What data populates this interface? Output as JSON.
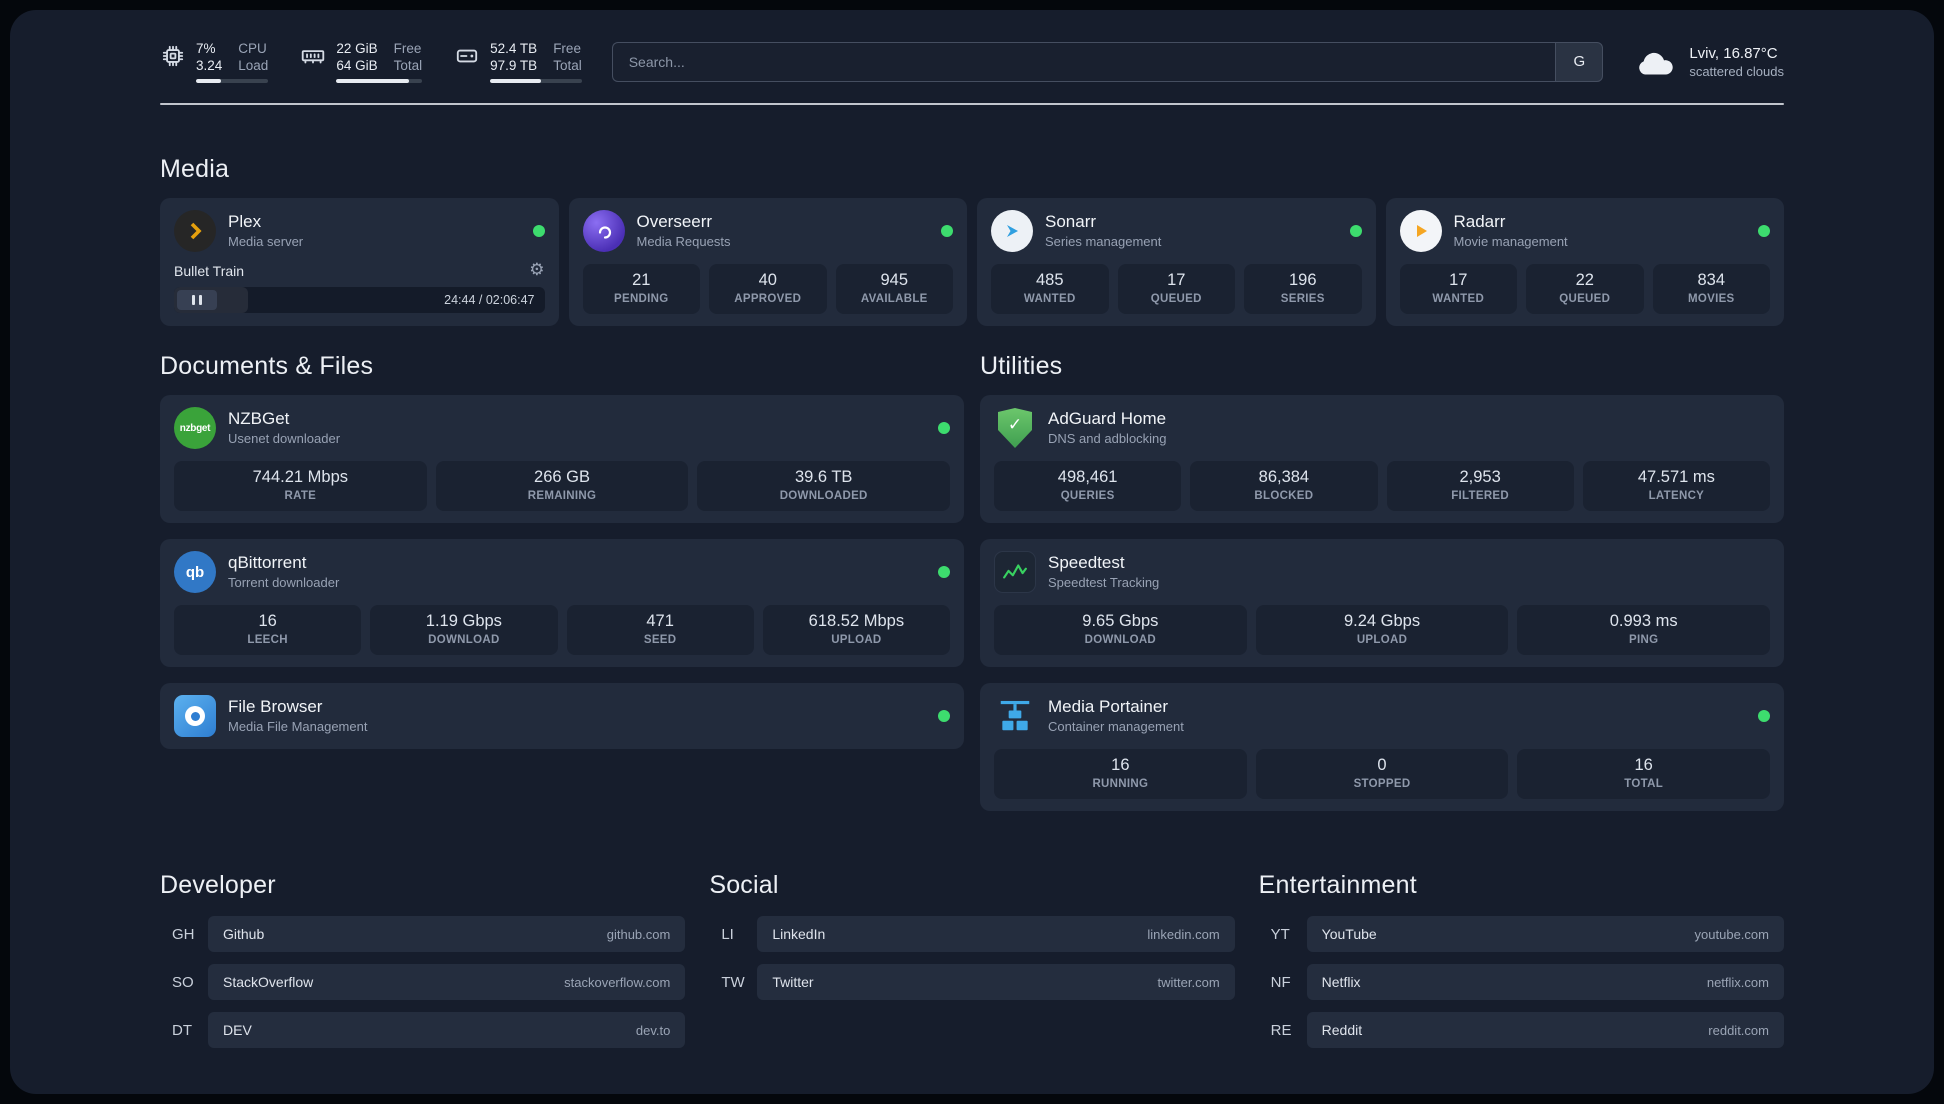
{
  "topbar": {
    "cpu": {
      "value": "7%",
      "sub": "3.24",
      "labels": [
        "CPU",
        "Load"
      ],
      "percent": 35
    },
    "ram": {
      "value": "22 GiB",
      "sub": "64 GiB",
      "labels": [
        "Free",
        "Total"
      ],
      "percent": 85
    },
    "disk": {
      "value": "52.4 TB",
      "sub": "97.9 TB",
      "labels": [
        "Free",
        "Total"
      ],
      "percent": 55
    },
    "search": {
      "placeholder": "Search...",
      "button_label": "G"
    },
    "weather": {
      "location": "Lviv, 16.87°C",
      "condition": "scattered clouds"
    }
  },
  "section_titles": {
    "media": "Media",
    "documents": "Documents & Files",
    "utilities": "Utilities",
    "developer": "Developer",
    "social": "Social",
    "entertainment": "Entertainment"
  },
  "media": [
    {
      "name": "Plex",
      "desc": "Media server",
      "now_playing": {
        "title": "Bullet Train",
        "time": "24:44 / 02:06:47",
        "progress_percent": 20
      }
    },
    {
      "name": "Overseerr",
      "desc": "Media Requests",
      "stats": [
        {
          "value": "21",
          "label": "PENDING"
        },
        {
          "value": "40",
          "label": "APPROVED"
        },
        {
          "value": "945",
          "label": "AVAILABLE"
        }
      ]
    },
    {
      "name": "Sonarr",
      "desc": "Series management",
      "stats": [
        {
          "value": "485",
          "label": "WANTED"
        },
        {
          "value": "17",
          "label": "QUEUED"
        },
        {
          "value": "196",
          "label": "SERIES"
        }
      ]
    },
    {
      "name": "Radarr",
      "desc": "Movie management",
      "stats": [
        {
          "value": "17",
          "label": "WANTED"
        },
        {
          "value": "22",
          "label": "QUEUED"
        },
        {
          "value": "834",
          "label": "MOVIES"
        }
      ]
    }
  ],
  "documents": [
    {
      "name": "NZBGet",
      "desc": "Usenet downloader",
      "stats": [
        {
          "value": "744.21 Mbps",
          "label": "RATE"
        },
        {
          "value": "266 GB",
          "label": "REMAINING"
        },
        {
          "value": "39.6 TB",
          "label": "DOWNLOADED"
        }
      ]
    },
    {
      "name": "qBittorrent",
      "desc": "Torrent downloader",
      "stats": [
        {
          "value": "16",
          "label": "LEECH"
        },
        {
          "value": "1.19 Gbps",
          "label": "DOWNLOAD"
        },
        {
          "value": "471",
          "label": "SEED"
        },
        {
          "value": "618.52 Mbps",
          "label": "UPLOAD"
        }
      ]
    },
    {
      "name": "File Browser",
      "desc": "Media File Management"
    }
  ],
  "utilities": [
    {
      "name": "AdGuard Home",
      "desc": "DNS and adblocking",
      "stats": [
        {
          "value": "498,461",
          "label": "QUERIES"
        },
        {
          "value": "86,384",
          "label": "BLOCKED"
        },
        {
          "value": "2,953",
          "label": "FILTERED"
        },
        {
          "value": "47.571 ms",
          "label": "LATENCY"
        }
      ]
    },
    {
      "name": "Speedtest",
      "desc": "Speedtest Tracking",
      "stats": [
        {
          "value": "9.65 Gbps",
          "label": "DOWNLOAD"
        },
        {
          "value": "9.24 Gbps",
          "label": "UPLOAD"
        },
        {
          "value": "0.993 ms",
          "label": "PING"
        }
      ]
    },
    {
      "name": "Media Portainer",
      "desc": "Container management",
      "stats": [
        {
          "value": "16",
          "label": "RUNNING"
        },
        {
          "value": "0",
          "label": "STOPPED"
        },
        {
          "value": "16",
          "label": "TOTAL"
        }
      ]
    }
  ],
  "bookmarks": {
    "developer": [
      {
        "abbr": "GH",
        "name": "Github",
        "domain": "github.com"
      },
      {
        "abbr": "SO",
        "name": "StackOverflow",
        "domain": "stackoverflow.com"
      },
      {
        "abbr": "DT",
        "name": "DEV",
        "domain": "dev.to"
      }
    ],
    "social": [
      {
        "abbr": "LI",
        "name": "LinkedIn",
        "domain": "linkedin.com"
      },
      {
        "abbr": "TW",
        "name": "Twitter",
        "domain": "twitter.com"
      }
    ],
    "entertainment": [
      {
        "abbr": "YT",
        "name": "YouTube",
        "domain": "youtube.com"
      },
      {
        "abbr": "NF",
        "name": "Netflix",
        "domain": "netflix.com"
      },
      {
        "abbr": "RE",
        "name": "Reddit",
        "domain": "reddit.com"
      }
    ]
  },
  "icons": {
    "gear": "⚙",
    "check": "✓",
    "nzbget_label": "nzbget",
    "qb_label": "qb"
  },
  "colors": {
    "page_bg": "#161d2c",
    "card_bg": "#222b3c",
    "tile_bg": "#1a2231",
    "status_online": "#3ddc6e",
    "plex_amber": "#e5a00d",
    "overseerr_purple": "#5f3fc4",
    "sonarr_blue": "#2f9fe0",
    "radarr_amber": "#f5a623",
    "nzbget_green": "#3aa33a",
    "qbittorrent_blue": "#3178c6",
    "adguard_green": "#4caf50",
    "speedtest_green": "#38d160",
    "portainer_blue": "#3fa9e8",
    "filebrowser_blue": "#3b8fdd"
  }
}
